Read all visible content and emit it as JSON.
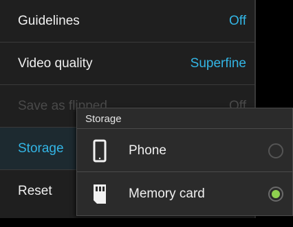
{
  "settings": {
    "items": [
      {
        "label": "Guidelines",
        "value": "Off"
      },
      {
        "label": "Video quality",
        "value": "Superfine"
      },
      {
        "label": "Save as flipped",
        "value": "Off"
      },
      {
        "label": "Storage",
        "value": ""
      },
      {
        "label": "Reset",
        "value": ""
      }
    ]
  },
  "storage_dialog": {
    "title": "Storage",
    "options": [
      {
        "label": "Phone",
        "icon": "phone-icon",
        "selected": false
      },
      {
        "label": "Memory card",
        "icon": "memory-card-icon",
        "selected": true
      }
    ]
  },
  "colors": {
    "accent": "#33b5e5",
    "radio_selected": "#8fd14f",
    "background": "#1f1f1f"
  }
}
